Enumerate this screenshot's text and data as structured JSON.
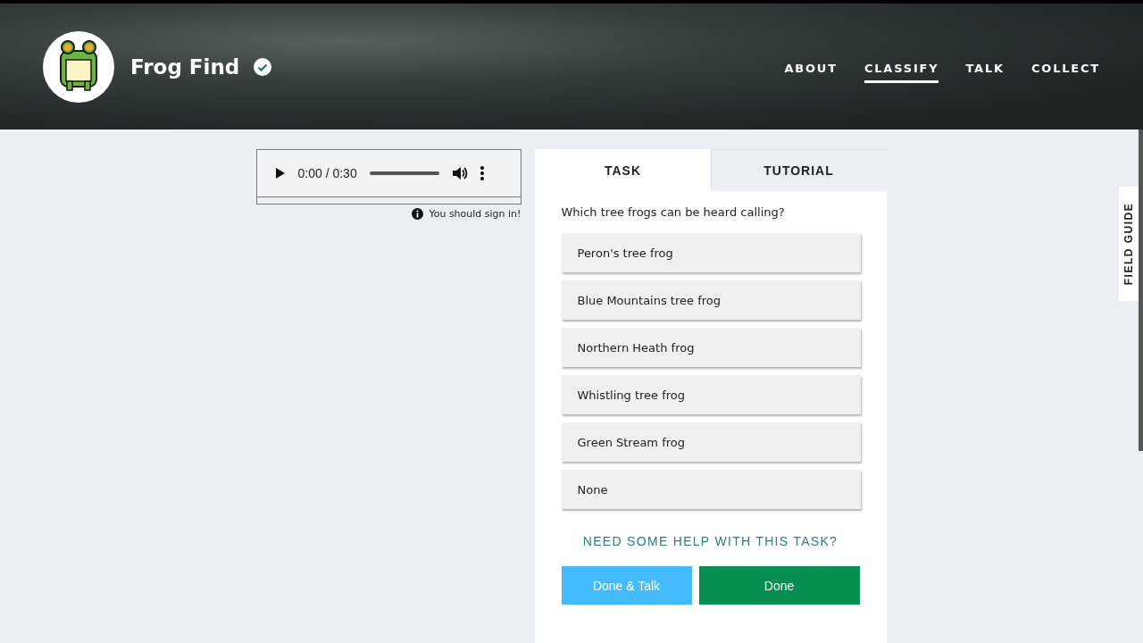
{
  "header": {
    "title": "Frog Find",
    "verified": true,
    "nav": [
      {
        "label": "ABOUT",
        "selected": false
      },
      {
        "label": "CLASSIFY",
        "selected": true
      },
      {
        "label": "TALK",
        "selected": false
      },
      {
        "label": "COLLECT",
        "selected": false
      }
    ]
  },
  "audio": {
    "time": "0:00 / 0:30",
    "notice": "You should sign in!"
  },
  "task_panel": {
    "tabs": [
      {
        "label": "TASK",
        "selected": true
      },
      {
        "label": "TUTORIAL",
        "selected": false
      }
    ],
    "question": "Which tree frogs can be heard calling?",
    "answers": [
      "Peron's tree frog",
      "Blue Mountains tree frog",
      "Northern Heath frog",
      "Whistling tree frog",
      "Green Stream frog",
      "None"
    ],
    "help_link": "NEED SOME HELP WITH THIS TASK?",
    "buttons": [
      {
        "label": "Done & Talk",
        "kind": "talk"
      },
      {
        "label": "Done",
        "kind": "done"
      }
    ]
  },
  "field_guide": "FIELD GUIDE"
}
